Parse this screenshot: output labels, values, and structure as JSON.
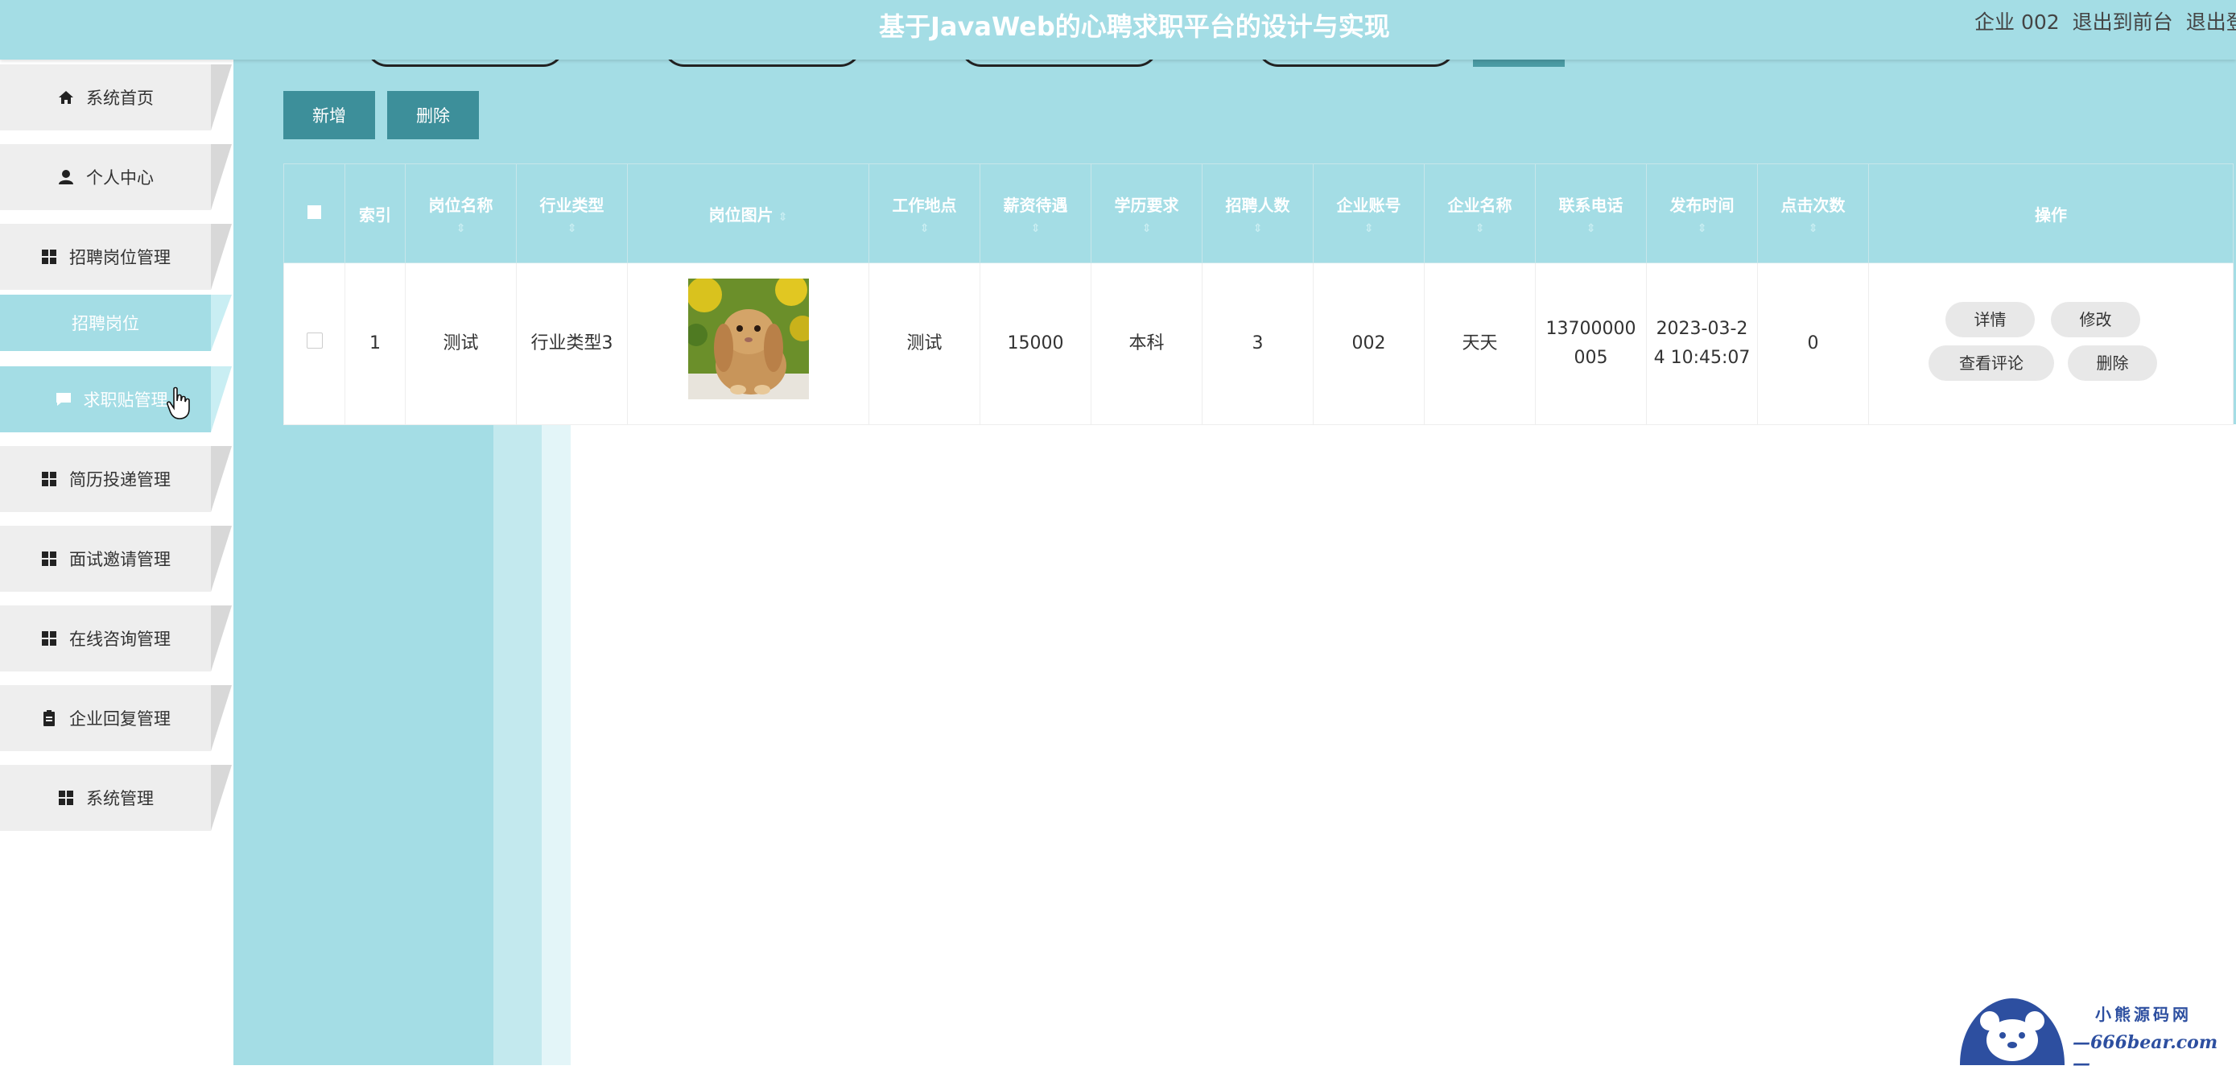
{
  "header": {
    "title": "基于JavaWeb的心聘求职平台的设计与实现",
    "user": "企业 002",
    "go_front": "退出到前台",
    "logout": "退出登录"
  },
  "sidebar": {
    "items": [
      {
        "label": "系统首页",
        "icon": "home-icon"
      },
      {
        "label": "个人中心",
        "icon": "user-icon"
      },
      {
        "label": "招聘岗位管理",
        "icon": "grid-icon"
      },
      {
        "label": "招聘岗位",
        "sub": true
      },
      {
        "label": "求职贴管理",
        "icon": "chat-icon",
        "active": true
      },
      {
        "label": "简历投递管理",
        "icon": "grid-icon"
      },
      {
        "label": "面试邀请管理",
        "icon": "grid-icon"
      },
      {
        "label": "在线咨询管理",
        "icon": "grid-icon"
      },
      {
        "label": "企业回复管理",
        "icon": "clipboard-icon"
      },
      {
        "label": "系统管理",
        "icon": "grid-icon"
      }
    ]
  },
  "toolbar": {
    "add": "新增",
    "delete": "删除"
  },
  "table": {
    "headers": [
      "索引",
      "岗位名称",
      "行业类型",
      "岗位图片",
      "工作地点",
      "薪资待遇",
      "学历要求",
      "招聘人数",
      "企业账号",
      "企业名称",
      "联系电话",
      "发布时间",
      "点击次数",
      "操作"
    ],
    "rows": [
      {
        "index": "1",
        "name": "测试",
        "industry": "行业类型3",
        "location": "测试",
        "salary": "15000",
        "education": "本科",
        "count": "3",
        "account": "002",
        "company": "天天",
        "phone_line1": "13700000",
        "phone_line2": "005",
        "time_line1": "2023-03-2",
        "time_line2": "4 10:45:07",
        "clicks": "0"
      }
    ],
    "actions": {
      "detail": "详情",
      "edit": "修改",
      "comments": "查看评论",
      "delete": "删除"
    }
  },
  "watermark": {
    "line1": "小熊源码网",
    "line2": "—666bear.com—"
  },
  "colors": {
    "accent": "#a4dde5",
    "button": "#3d8f9a"
  }
}
